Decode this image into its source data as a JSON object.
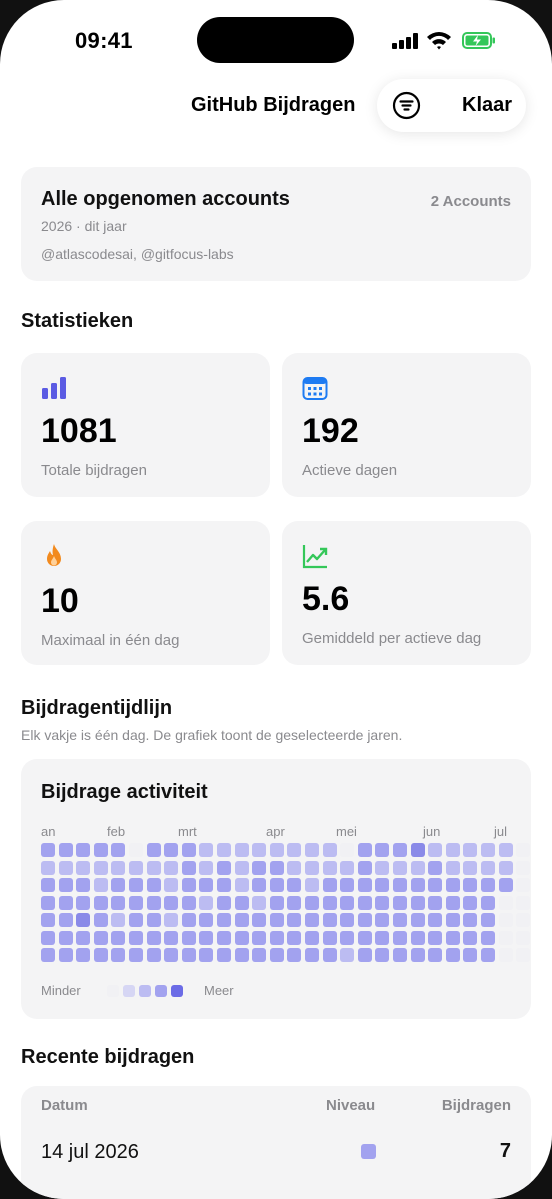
{
  "status_bar": {
    "time": "09:41"
  },
  "nav": {
    "title": "GitHub Bijdragen",
    "done_label": "Klaar",
    "filter_icon": "filter-icon"
  },
  "accounts_card": {
    "title": "Alle opgenomen accounts",
    "count": "2 Accounts",
    "period": "2026 · dit jaar",
    "accounts": "@atlascodesai, @gitfocus-labs"
  },
  "statistics": {
    "title": "Statistieken",
    "cards": [
      {
        "icon": "bar-chart-icon",
        "value": "1081",
        "label": "Totale bijdragen"
      },
      {
        "icon": "calendar-icon",
        "value": "192",
        "label": "Actieve dagen"
      },
      {
        "icon": "flame-icon",
        "value": "10",
        "label": "Maximaal in één dag"
      },
      {
        "icon": "trend-up-icon",
        "value": "5.6",
        "label": "Gemiddeld per actieve dag"
      }
    ]
  },
  "timeline": {
    "title": "Bijdragentijdlijn",
    "subtitle": "Elk vakje is één dag. De grafiek toont de geselecteerde jaren.",
    "card_title": "Bijdrage activiteit",
    "months": [
      "an",
      "feb",
      "mrt",
      "apr",
      "mei",
      "jun",
      "jul"
    ],
    "legend_less": "Minder",
    "legend_more": "Meer",
    "level_colors": [
      "#f1f1f4",
      "#d6d6f4",
      "#bcbcf2",
      "#a2a2ef",
      "#8a8ae8"
    ],
    "weeks": [
      [
        3,
        2,
        3,
        3,
        3,
        3,
        3
      ],
      [
        3,
        2,
        3,
        3,
        3,
        3,
        3
      ],
      [
        3,
        2,
        3,
        3,
        4,
        3,
        3
      ],
      [
        3,
        2,
        2,
        3,
        3,
        3,
        3
      ],
      [
        3,
        2,
        3,
        3,
        2,
        3,
        3
      ],
      [
        0,
        2,
        3,
        3,
        3,
        3,
        3
      ],
      [
        3,
        2,
        3,
        3,
        3,
        3,
        3
      ],
      [
        3,
        2,
        2,
        3,
        2,
        3,
        3
      ],
      [
        3,
        3,
        3,
        3,
        3,
        3,
        3
      ],
      [
        2,
        2,
        3,
        2,
        3,
        3,
        3
      ],
      [
        2,
        3,
        3,
        3,
        3,
        3,
        3
      ],
      [
        2,
        2,
        2,
        3,
        3,
        3,
        3
      ],
      [
        2,
        3,
        3,
        2,
        3,
        3,
        3
      ],
      [
        2,
        3,
        3,
        3,
        3,
        3,
        3
      ],
      [
        2,
        2,
        3,
        3,
        3,
        3,
        3
      ],
      [
        2,
        2,
        2,
        3,
        3,
        3,
        3
      ],
      [
        2,
        2,
        3,
        3,
        3,
        3,
        3
      ],
      [
        0,
        2,
        3,
        3,
        3,
        3,
        2
      ],
      [
        3,
        3,
        3,
        3,
        3,
        3,
        3
      ],
      [
        3,
        2,
        3,
        3,
        3,
        3,
        3
      ],
      [
        3,
        2,
        3,
        3,
        3,
        3,
        3
      ],
      [
        4,
        2,
        3,
        3,
        3,
        3,
        3
      ],
      [
        2,
        3,
        3,
        3,
        3,
        3,
        3
      ],
      [
        2,
        2,
        3,
        3,
        3,
        3,
        3
      ],
      [
        2,
        2,
        3,
        3,
        3,
        3,
        3
      ],
      [
        2,
        2,
        3,
        3,
        3,
        3,
        3
      ],
      [
        2,
        2,
        3,
        0,
        0,
        0,
        0
      ],
      [
        0,
        0,
        0,
        0,
        0,
        0,
        0
      ]
    ],
    "legend_levels": [
      0,
      1,
      2,
      3,
      4
    ]
  },
  "recent": {
    "title": "Recente bijdragen",
    "headers": {
      "date": "Datum",
      "level": "Niveau",
      "count": "Bijdragen"
    },
    "rows": [
      {
        "date": "14 jul 2026",
        "level": 3,
        "count": "7"
      }
    ]
  }
}
